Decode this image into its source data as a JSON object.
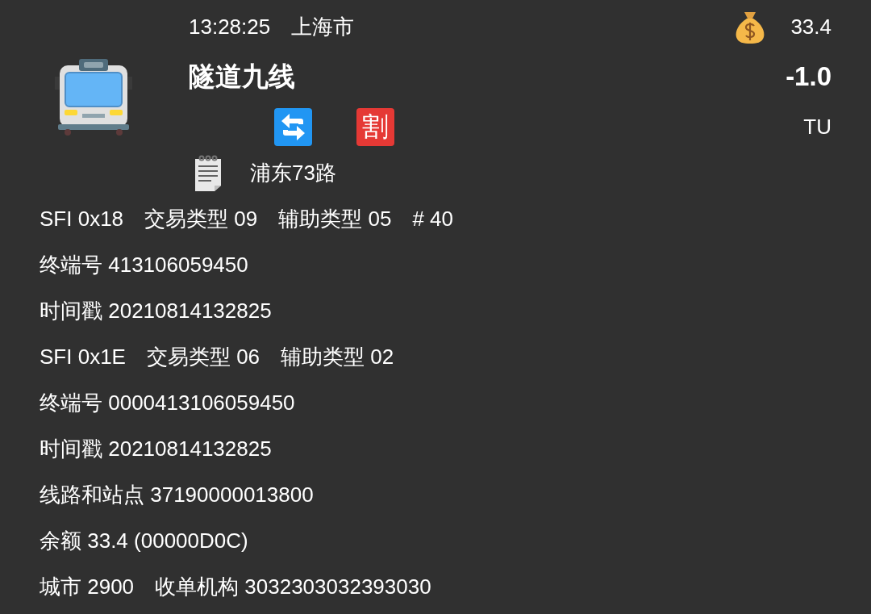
{
  "header": {
    "time": "13:28:25",
    "city": "上海市",
    "route_name": "隧道九线",
    "badges": [
      {
        "kind": "transfer"
      },
      {
        "kind": "discount",
        "text": "割"
      }
    ],
    "note": "浦东73路",
    "balance": "33.4",
    "amount": "-1.0",
    "card_type": "TU"
  },
  "records": [
    {
      "fields": [
        "SFI 0x18",
        "交易类型 09",
        "辅助类型 05",
        "# 40"
      ]
    },
    {
      "fields": [
        "终端号 413106059450"
      ]
    },
    {
      "fields": [
        "时间戳 20210814132825"
      ]
    },
    {
      "fields": [
        "SFI 0x1E",
        "交易类型 06",
        "辅助类型 02"
      ]
    },
    {
      "fields": [
        "终端号 0000413106059450"
      ]
    },
    {
      "fields": [
        "时间戳 20210814132825"
      ]
    },
    {
      "fields": [
        "线路和站点 37190000013800"
      ]
    },
    {
      "fields": [
        "余额 33.4 (00000D0C)"
      ]
    },
    {
      "fields": [
        "城市 2900",
        "收单机构 3032303032393030"
      ]
    }
  ]
}
